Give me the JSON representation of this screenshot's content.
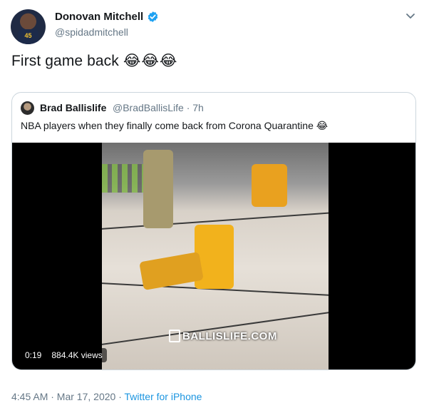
{
  "author": {
    "display_name": "Donovan Mitchell",
    "handle": "@spidadmitchell",
    "avatar_jersey_number": "45"
  },
  "tweet": {
    "text": "First game back",
    "emoji": "😂😂😂"
  },
  "quoted": {
    "display_name": "Brad Ballislife",
    "handle_time": "@BradBallisLife · 7h",
    "text": "NBA players when they finally come back from Corona Quarantine 😂",
    "video": {
      "watermark": "BALLISLIFE.COM",
      "duration": "0:19",
      "views": "884.4K views"
    }
  },
  "footer": {
    "time_date": "4:45 AM · Mar 17, 2020 · ",
    "source": "Twitter for iPhone"
  },
  "colors": {
    "verified": "#1da1f2",
    "link": "#1b95e0",
    "secondary_text": "#657786"
  },
  "icons": [
    "verified-badge-icon",
    "chevron-down-icon",
    "ballislife-logo-icon"
  ]
}
